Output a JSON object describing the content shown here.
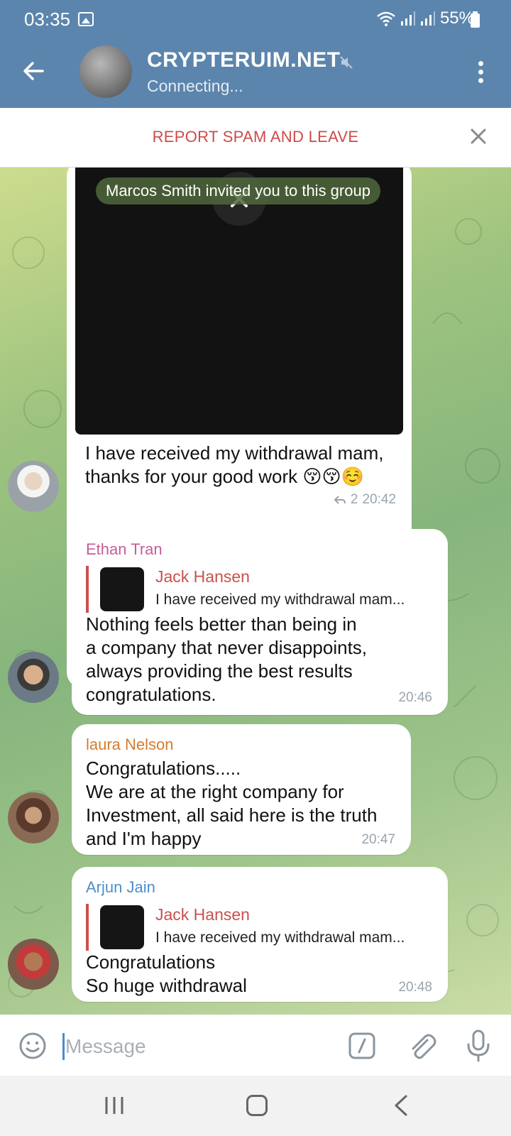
{
  "status_bar": {
    "time": "03:35",
    "battery": "55%"
  },
  "header": {
    "title": "CRYPTERUIM.NET",
    "subtitle": "Connecting..."
  },
  "report_bar": {
    "label": "REPORT SPAM AND LEAVE"
  },
  "pinned_notice": "Marcos Smith invited you to this group",
  "messages": [
    {
      "text": "I have received my withdrawal mam,\nthanks for your good work 😚😚☺️",
      "replies": "2",
      "time": "20:42"
    },
    {
      "sender": "Ethan Tran",
      "sender_color": "#c75d9a",
      "reply_to": {
        "name": "Jack Hansen",
        "text": "I have received my withdrawal mam..."
      },
      "text": "Nothing feels better than being in\na company that never disappoints,\nalways providing the best results\ncongratulations.",
      "time": "20:46"
    },
    {
      "sender": "laura Nelson",
      "sender_color": "#d37d2c",
      "text": "Congratulations.....\nWe are at the right company for\nInvestment, all said here is the truth\nand I'm happy",
      "time": "20:47"
    },
    {
      "sender": "Arjun Jain",
      "sender_color": "#4f8fc6",
      "reply_to": {
        "name": "Jack Hansen",
        "text": "I have received my withdrawal mam..."
      },
      "text": "Congratulations\nSo huge withdrawal",
      "time": "20:48"
    }
  ],
  "composer": {
    "placeholder": "Message"
  },
  "colors": {
    "header": "#5b85ad",
    "report": "#cf4a4a",
    "reply_accent": "#c9514e"
  }
}
